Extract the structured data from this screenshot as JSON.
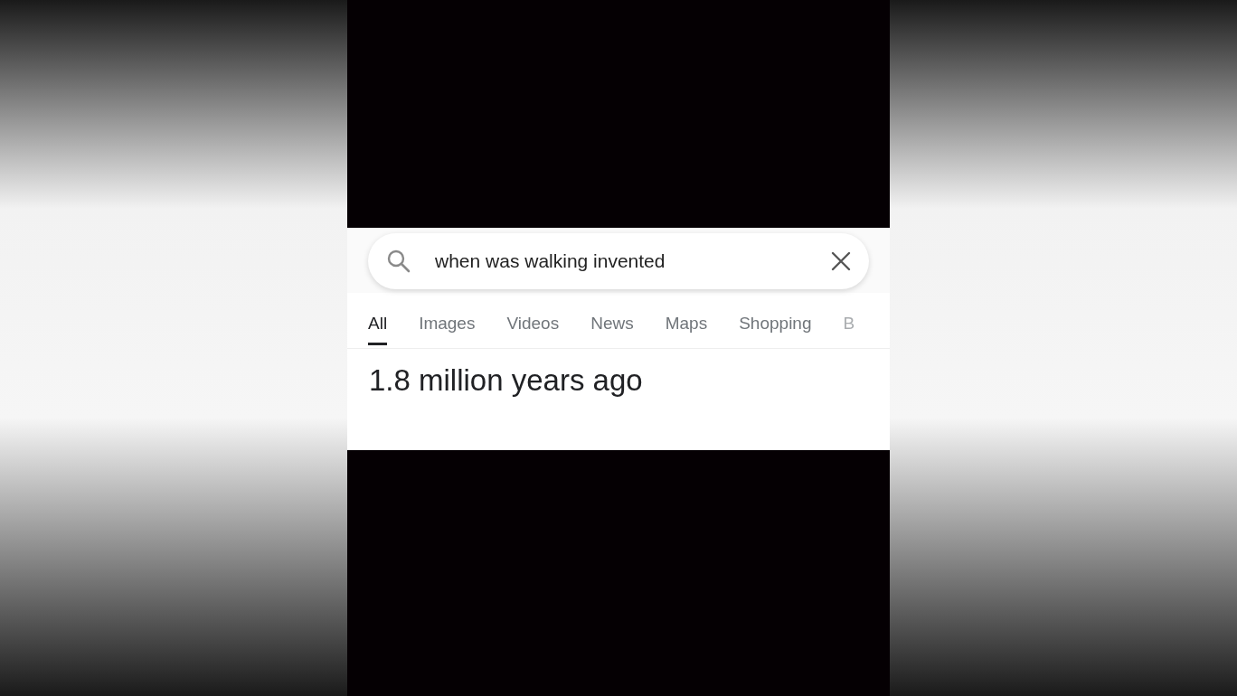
{
  "search": {
    "value": "when was walking invented"
  },
  "tabs": [
    {
      "label": "All",
      "selected": true
    },
    {
      "label": "Images",
      "selected": false
    },
    {
      "label": "Videos",
      "selected": false
    },
    {
      "label": "News",
      "selected": false
    },
    {
      "label": "Maps",
      "selected": false
    },
    {
      "label": "Shopping",
      "selected": false
    },
    {
      "label": "B",
      "selected": false
    }
  ],
  "answer": "1.8 million years ago"
}
